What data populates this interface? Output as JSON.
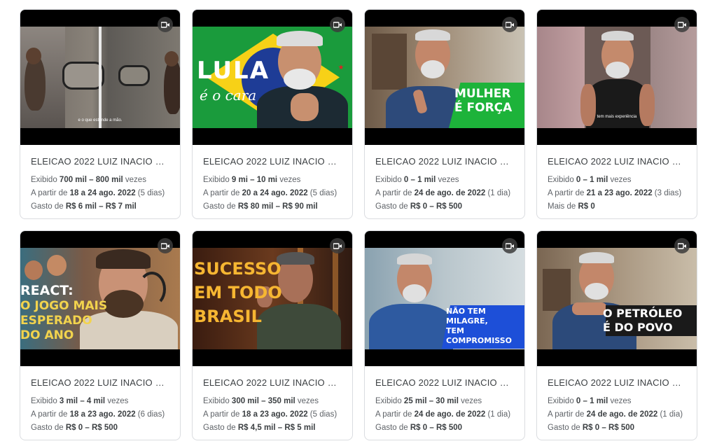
{
  "cards": [
    {
      "title": "ELEICAO 2022 LUIZ INACIO LU...",
      "shown_prefix": "Exibido ",
      "shown": "700 mil – 800 mil",
      "shown_suffix": " vezes",
      "date_prefix": "A partir de ",
      "date": "18 a 24 ago. 2022",
      "date_suffix": " (5 dias)",
      "spent_prefix": "Gasto de ",
      "spent": "R$ 6 mil – R$ 7 mil",
      "thumb_caption": "e o que estende a mão."
    },
    {
      "title": "ELEICAO 2022 LUIZ INACIO LU...",
      "shown_prefix": "Exibido ",
      "shown": "9 mi – 10 mi",
      "shown_suffix": " vezes",
      "date_prefix": "A partir de ",
      "date": "20 a 24 ago. 2022",
      "date_suffix": " (5 dias)",
      "spent_prefix": "Gasto de ",
      "spent": "R$ 80 mil – R$ 90 mil",
      "thumb_caption": "LULA",
      "thumb_caption2": "é o cara"
    },
    {
      "title": "ELEICAO 2022 LUIZ INACIO LU...",
      "shown_prefix": "Exibido ",
      "shown": "0 – 1 mil",
      "shown_suffix": " vezes",
      "date_prefix": "A partir de ",
      "date": "24 de ago. de 2022",
      "date_suffix": " (1 dia)",
      "spent_prefix": "Gasto de ",
      "spent": "R$ 0 – R$ 500",
      "thumb_caption": "MULHER",
      "thumb_caption2": "É FORÇA"
    },
    {
      "title": "ELEICAO 2022 LUIZ INACIO LU...",
      "shown_prefix": "Exibido ",
      "shown": "0 – 1 mil",
      "shown_suffix": " vezes",
      "date_prefix": "A partir de ",
      "date": "21 a 23 ago. 2022",
      "date_suffix": " (3 dias)",
      "spent_prefix": "Mais de ",
      "spent": "R$ 0",
      "thumb_caption": "tem mais experiência"
    },
    {
      "title": "ELEICAO 2022 LUIZ INACIO LU...",
      "shown_prefix": "Exibido ",
      "shown": "3 mil – 4 mil",
      "shown_suffix": " vezes",
      "date_prefix": "A partir de ",
      "date": "18 a 23 ago. 2022",
      "date_suffix": " (6 dias)",
      "spent_prefix": "Gasto de ",
      "spent": "R$ 0 – R$ 500",
      "thumb_caption": "REACT:",
      "thumb_caption2": "O JOGO MAIS",
      "thumb_caption3": "ESPERADO",
      "thumb_caption4": "DO ANO"
    },
    {
      "title": "ELEICAO 2022 LUIZ INACIO LU...",
      "shown_prefix": "Exibido ",
      "shown": "300 mil – 350 mil",
      "shown_suffix": " vezes",
      "date_prefix": "A partir de ",
      "date": "18 a 23 ago. 2022",
      "date_suffix": " (5 dias)",
      "spent_prefix": "Gasto de ",
      "spent": "R$ 4,5 mil – R$ 5 mil",
      "thumb_caption": "SUCESSO",
      "thumb_caption2": "EM TODO",
      "thumb_caption3": "BRASIL"
    },
    {
      "title": "ELEICAO 2022 LUIZ INACIO LU...",
      "shown_prefix": "Exibido ",
      "shown": "25 mil – 30 mil",
      "shown_suffix": " vezes",
      "date_prefix": "A partir de ",
      "date": "24 de ago. de 2022",
      "date_suffix": " (1 dia)",
      "spent_prefix": "Gasto de ",
      "spent": "R$ 0 – R$ 500",
      "thumb_caption": "NÃO TEM",
      "thumb_caption2": "MILAGRE,",
      "thumb_caption3": "TEM",
      "thumb_caption4": "COMPROMISSO"
    },
    {
      "title": "ELEICAO 2022 LUIZ INACIO LU...",
      "shown_prefix": "Exibido ",
      "shown": "0 – 1 mil",
      "shown_suffix": " vezes",
      "date_prefix": "A partir de ",
      "date": "24 de ago. de 2022",
      "date_suffix": " (1 dia)",
      "spent_prefix": "Gasto de ",
      "spent": "R$ 0 – R$ 500",
      "thumb_caption": "O PETRÓLEO",
      "thumb_caption2": "É DO POVO"
    }
  ],
  "icons": {
    "video": "video-camera-icon"
  },
  "colors": {
    "brand_green": "#1db33a",
    "flag_yellow": "#f7d117",
    "blue_banner": "#1d4fd8"
  }
}
